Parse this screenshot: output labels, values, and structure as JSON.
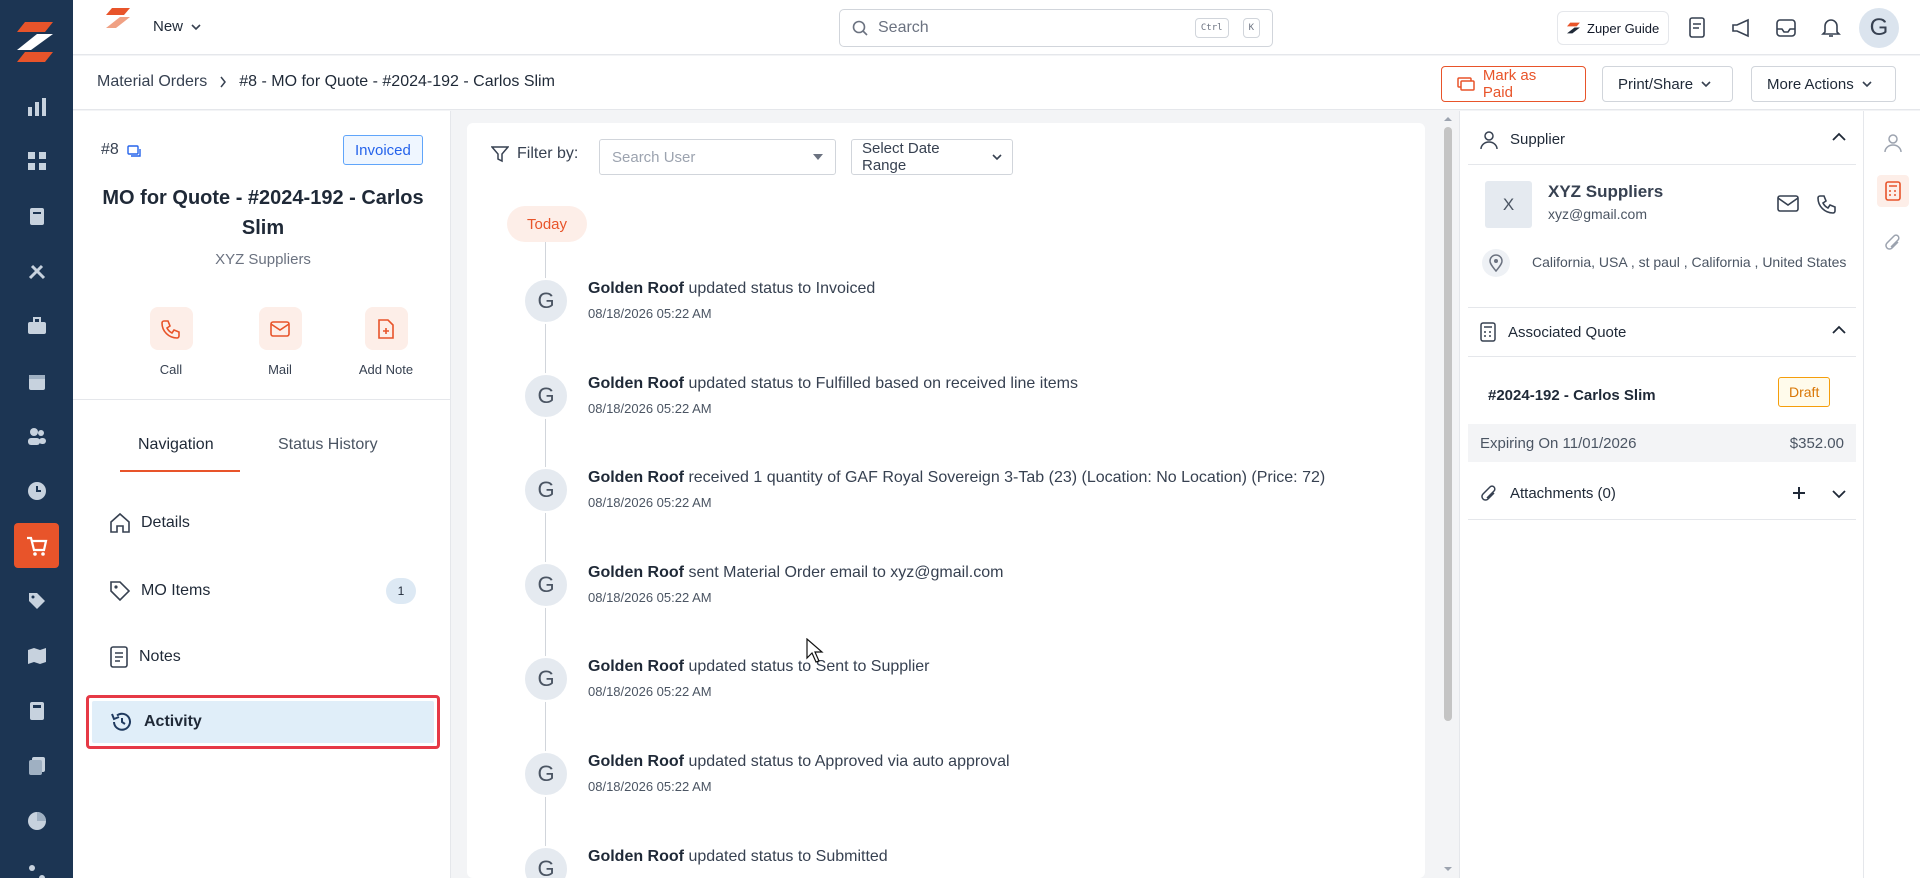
{
  "topbar": {
    "new_label": "New",
    "search_placeholder": "Search",
    "shortcut_ctrl": "Ctrl",
    "shortcut_key": "K",
    "guide_label": "Zuper Guide",
    "avatar_initial": "G"
  },
  "breadcrumb": {
    "parent": "Material Orders",
    "current": "#8 - MO for Quote - #2024-192 - Carlos Slim"
  },
  "header_actions": {
    "mark_paid": "Mark as Paid",
    "print_share": "Print/Share",
    "more_actions": "More Actions"
  },
  "order": {
    "number": "#8",
    "status": "Invoiced",
    "title": "MO for Quote - #2024-192 - Carlos Slim",
    "supplier": "XYZ Suppliers"
  },
  "quick_actions": [
    {
      "label": "Call",
      "icon": "phone-icon"
    },
    {
      "label": "Mail",
      "icon": "mail-icon"
    },
    {
      "label": "Add Note",
      "icon": "note-add-icon"
    }
  ],
  "tabs": {
    "navigation": "Navigation",
    "status_history": "Status History"
  },
  "nav_items": [
    {
      "label": "Details",
      "icon": "home-icon"
    },
    {
      "label": "MO Items",
      "icon": "tag-icon",
      "count": "1"
    },
    {
      "label": "Notes",
      "icon": "document-icon"
    },
    {
      "label": "Activity",
      "icon": "history-icon"
    }
  ],
  "filter": {
    "label": "Filter by:",
    "user_placeholder": "Search User",
    "date_label": "Select Date Range"
  },
  "timeline": {
    "group_label": "Today",
    "items": [
      {
        "initial": "G",
        "actor": "Golden Roof",
        "text": "updated status to Invoiced",
        "time": "08/18/2026 05:22 AM"
      },
      {
        "initial": "G",
        "actor": "Golden Roof",
        "text": "updated status to Fulfilled based on received line items",
        "time": "08/18/2026 05:22 AM"
      },
      {
        "initial": "G",
        "actor": "Golden Roof",
        "text": "received 1 quantity of GAF Royal Sovereign 3-Tab (23) (Location: No Location) (Price: 72)",
        "time": "08/18/2026 05:22 AM"
      },
      {
        "initial": "G",
        "actor": "Golden Roof",
        "text": "sent Material Order email to xyz@gmail.com",
        "time": "08/18/2026 05:22 AM"
      },
      {
        "initial": "G",
        "actor": "Golden Roof",
        "text": "updated status to Sent to Supplier",
        "time": "08/18/2026 05:22 AM"
      },
      {
        "initial": "G",
        "actor": "Golden Roof",
        "text": "updated status to Approved via auto approval",
        "time": "08/18/2026 05:22 AM"
      },
      {
        "initial": "G",
        "actor": "Golden Roof",
        "text": "updated status to Submitted",
        "time": ""
      }
    ]
  },
  "supplier_card": {
    "header": "Supplier",
    "initial": "X",
    "name": "XYZ Suppliers",
    "email": "xyz@gmail.com",
    "address": "California, USA , st paul , California , United States"
  },
  "associated_quote": {
    "header": "Associated Quote",
    "number": "#2024-192 - Carlos Slim",
    "status": "Draft",
    "expiring": "Expiring On 11/01/2026",
    "amount": "$352.00"
  },
  "attachments": {
    "header": "Attachments (0)"
  },
  "colors": {
    "brand": "#e8542a",
    "rail": "#1c3553",
    "accent_blue": "#2563eb"
  }
}
